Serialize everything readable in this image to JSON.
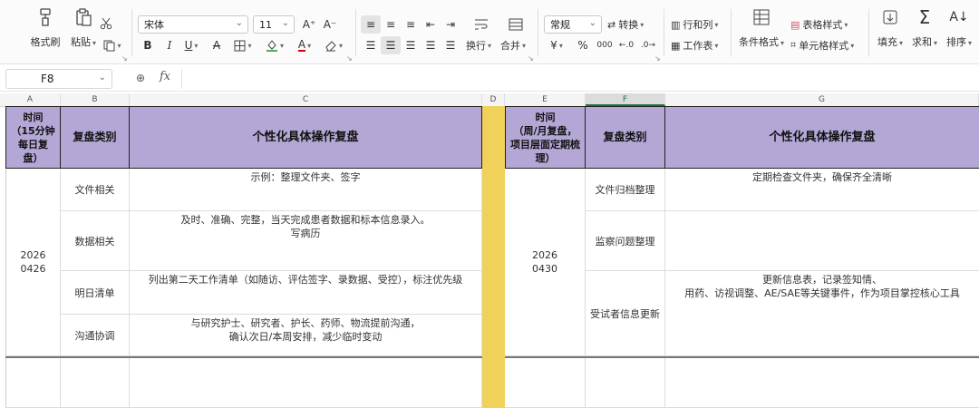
{
  "ribbon": {
    "format_painter": "格式刷",
    "paste": "粘贴",
    "cut_menu": "",
    "font_name": "宋体",
    "font_size": "11",
    "number_format": "常规",
    "convert": "转换",
    "row_col": "行和列",
    "worksheet": "工作表",
    "conditional_format": "条件格式",
    "table_style": "表格样式",
    "cell_style": "单元格样式",
    "wrap": "换行",
    "merge": "合并",
    "fill": "填充",
    "sum": "求和",
    "sort": "排序",
    "percent": "%",
    "thousands": "000"
  },
  "formula_bar": {
    "cell_ref": "F8",
    "fx": "fx",
    "value": ""
  },
  "columns": [
    "A",
    "B",
    "C",
    "D",
    "E",
    "F",
    "G"
  ],
  "selected_column": "F",
  "sheet": {
    "header": {
      "a": "时间\n（15分钟\n每日复\n盘）",
      "b": "复盘类别",
      "c": "个性化具体操作复盘",
      "e": "时间\n（周/月复盘，\n项目层面定期梳\n理）",
      "f": "复盘类别",
      "g": "个性化具体操作复盘"
    },
    "daily_date": "2026\n0426",
    "daily_rows": [
      {
        "category": "文件相关",
        "detail": "示例：整理文件夹、签字"
      },
      {
        "category": "数据相关",
        "detail": "及时、准确、完整，当天完成患者数据和标本信息录入。\n写病历"
      },
      {
        "category": "明日清单",
        "detail": "列出第二天工作清单（如随访、评估签字、录数据、受控），标注优先级"
      },
      {
        "category": "沟通协调",
        "detail": "与研究护士、研究者、护长、药师、物流提前沟通，\n确认次日/本周安排，减少临时变动"
      }
    ],
    "period_date": "2026\n0430",
    "period_rows": [
      {
        "category": "文件归档整理",
        "detail": "定期检查文件夹，确保齐全清晰"
      },
      {
        "category": "监察问题整理",
        "detail": ""
      },
      {
        "category": "受试者信息更新",
        "detail": "更新信息表，记录签知情、\n用药、访视调整、AE/SAE等关键事件，作为项目掌控核心工具"
      }
    ]
  },
  "colors": {
    "header_fill": "#b4a7d6",
    "spacer_fill": "#f0d25a",
    "selection": "#217346"
  }
}
